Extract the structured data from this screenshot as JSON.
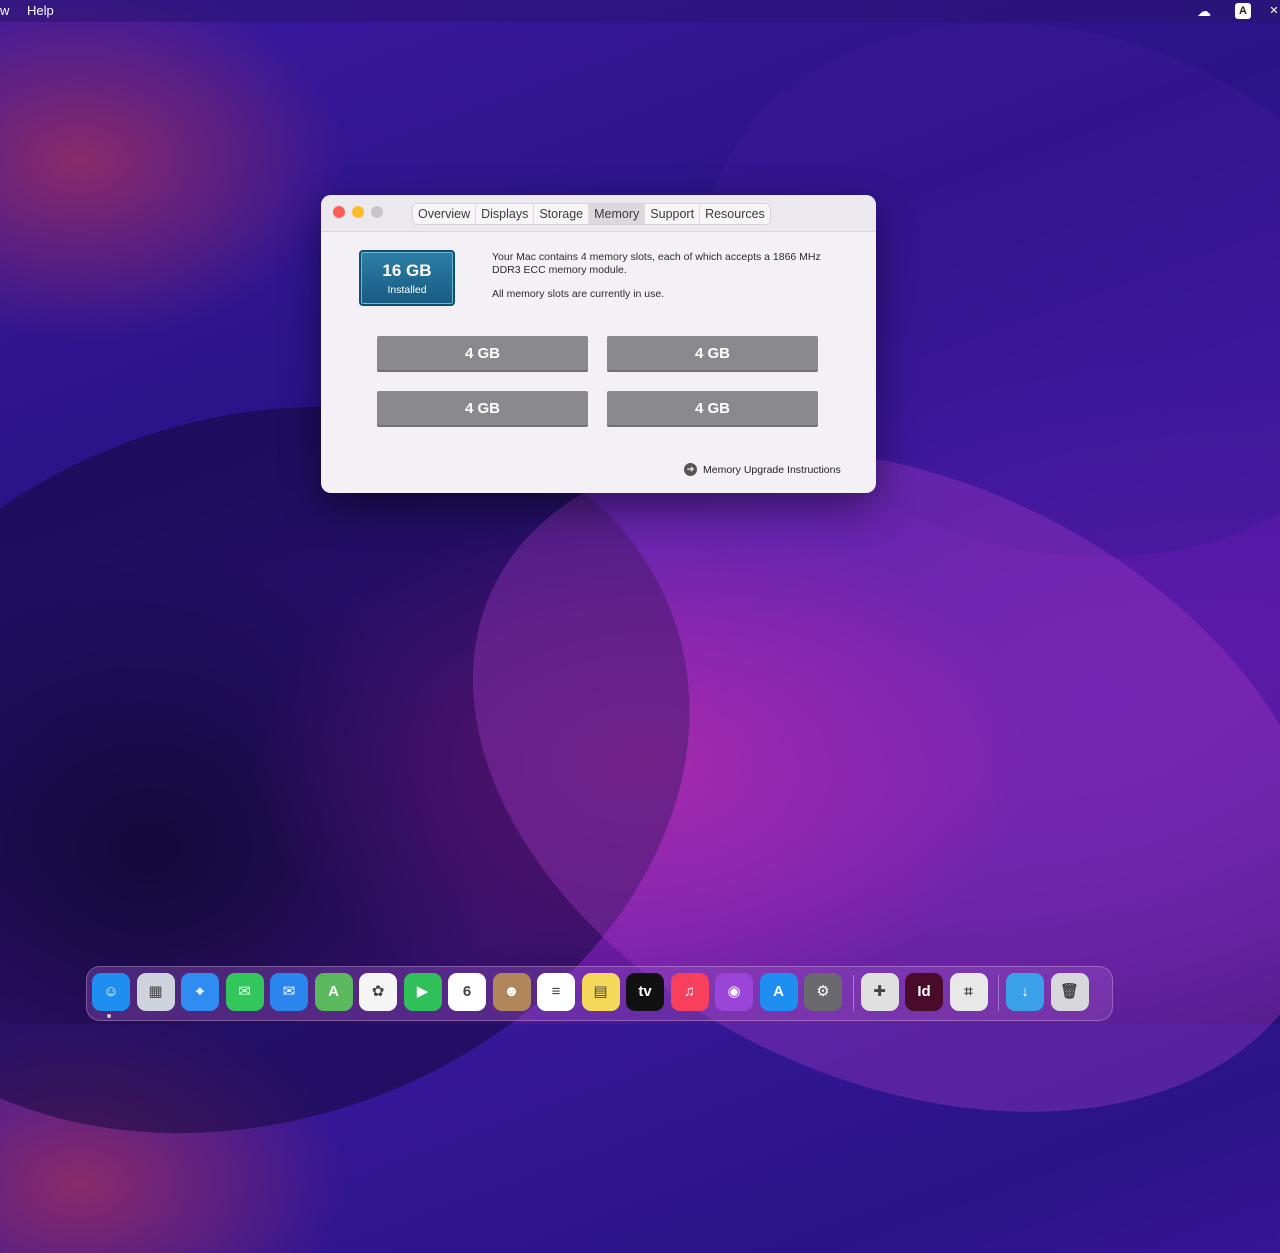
{
  "menubar": {
    "left_items": [
      "w",
      "Help"
    ],
    "status_icons": [
      "creative-cloud-icon",
      "input-source-icon",
      "close-x-icon"
    ],
    "input_source_label": "A"
  },
  "window": {
    "tabs": [
      "Overview",
      "Displays",
      "Storage",
      "Memory",
      "Support",
      "Resources"
    ],
    "active_tab": "Memory",
    "installed": {
      "size": "16 GB",
      "label": "Installed"
    },
    "description": [
      "Your Mac contains 4 memory slots, each of which accepts a 1866 MHz DDR3 ECC memory module.",
      "All memory slots are currently in use."
    ],
    "slots": [
      "4 GB",
      "4 GB",
      "4 GB",
      "4 GB"
    ],
    "upgrade_link": "Memory Upgrade Instructions"
  },
  "dock": {
    "apps": [
      {
        "name": "finder",
        "glyph": "☺",
        "color": "#1e8ff0"
      },
      {
        "name": "launchpad",
        "glyph": "▦",
        "color": "#cfd3dc"
      },
      {
        "name": "safari",
        "glyph": "⌖",
        "color": "#2f8cf0"
      },
      {
        "name": "messages",
        "glyph": "✉",
        "color": "#32c75a"
      },
      {
        "name": "mail",
        "glyph": "✉",
        "color": "#2a86ec"
      },
      {
        "name": "maps",
        "glyph": "A",
        "color": "#5ab95c"
      },
      {
        "name": "photos",
        "glyph": "✿",
        "color": "#f5f5f5"
      },
      {
        "name": "facetime",
        "glyph": "▶",
        "color": "#2fc05a"
      },
      {
        "name": "calendar",
        "glyph": "6",
        "color": "#ffffff"
      },
      {
        "name": "contacts",
        "glyph": "☻",
        "color": "#b0865a"
      },
      {
        "name": "reminders",
        "glyph": "≡",
        "color": "#ffffff"
      },
      {
        "name": "notes",
        "glyph": "▤",
        "color": "#f5d85a"
      },
      {
        "name": "apple-tv",
        "glyph": "tv",
        "color": "#111111"
      },
      {
        "name": "music",
        "glyph": "♫",
        "color": "#f8405c"
      },
      {
        "name": "podcasts",
        "glyph": "◉",
        "color": "#9a45d8"
      },
      {
        "name": "app-store",
        "glyph": "A",
        "color": "#1e8ff0"
      },
      {
        "name": "system-preferences",
        "glyph": "⚙",
        "color": "#6a6a6e"
      },
      {
        "name": "system-information",
        "glyph": "✚",
        "color": "#e0e0e0"
      },
      {
        "name": "indesign",
        "glyph": "Id",
        "color": "#4a0a2a"
      },
      {
        "name": "screenshot-utility",
        "glyph": "⌗",
        "color": "#e8e8e8"
      },
      {
        "name": "downloads-folder",
        "glyph": "↓",
        "color": "#3aa0e8"
      },
      {
        "name": "trash",
        "glyph": "🗑",
        "color": "#d8d8dc"
      }
    ]
  }
}
